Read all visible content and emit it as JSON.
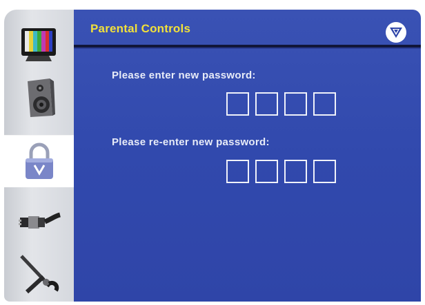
{
  "header": {
    "title": "Parental Controls",
    "logo_icon": "v-logo-icon"
  },
  "sidebar": {
    "items": [
      {
        "icon": "tv-color-bars-icon",
        "selected": false
      },
      {
        "icon": "speaker-icon",
        "selected": false
      },
      {
        "icon": "padlock-icon",
        "selected": true
      },
      {
        "icon": "cable-connector-icon",
        "selected": false
      },
      {
        "icon": "tools-icon",
        "selected": false
      }
    ]
  },
  "main": {
    "new_password_prompt": "Please enter new password:",
    "confirm_password_prompt": "Please re-enter new password:",
    "new_password_digits": [
      "",
      "",
      "",
      ""
    ],
    "confirm_password_digits": [
      "",
      "",
      "",
      ""
    ]
  },
  "colors": {
    "panel_blue": "#3149ad",
    "title_yellow": "#f2e13a",
    "text_white": "#e8ecf8"
  }
}
